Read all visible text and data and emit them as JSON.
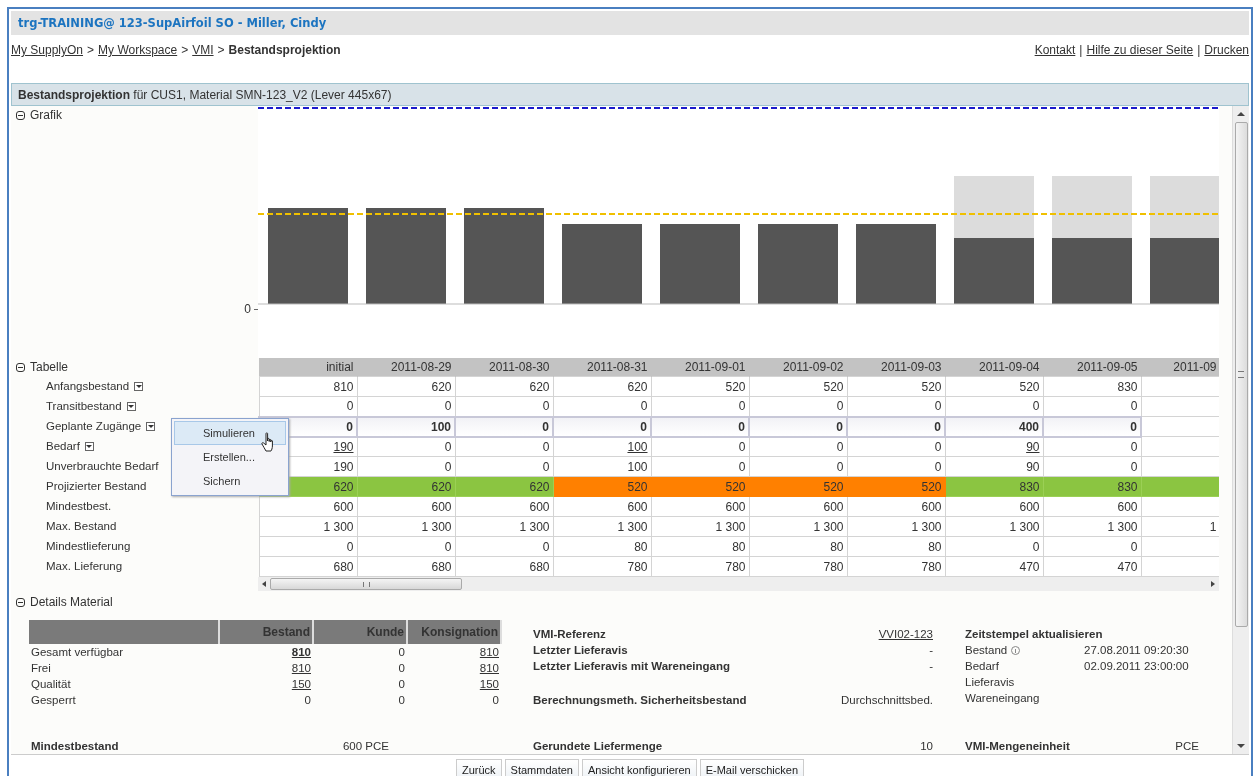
{
  "window": {
    "title": "trg-TRAINING@ 123-SupAirfoil SO - Miller, Cindy"
  },
  "breadcrumb": [
    {
      "kind": "link",
      "label": "My SupplyOn"
    },
    {
      "kind": "separator",
      "label": ">"
    },
    {
      "kind": "link",
      "label": "My Workspace"
    },
    {
      "kind": "separator",
      "label": ">"
    },
    {
      "kind": "link",
      "label": "VMI"
    },
    {
      "kind": "separator",
      "label": ">"
    },
    {
      "kind": "current",
      "label": "Bestandsprojektion"
    }
  ],
  "top_links": [
    {
      "kind": "link",
      "label": "Kontakt"
    },
    {
      "kind": "separator",
      "label": "|"
    },
    {
      "kind": "link",
      "label": "Hilfe zu dieser Seite"
    },
    {
      "kind": "separator",
      "label": "|"
    },
    {
      "kind": "link",
      "label": "Drucken"
    }
  ],
  "panel": {
    "title": "**Bestandsprojektion** für CUS1, Material SMN-123_V2 (Lever 445x67)"
  },
  "chart": {
    "label": "Grafik",
    "expanded": true,
    "y_tick": "0"
  },
  "table": {
    "label": "Tabelle",
    "expanded": true,
    "columns": [
      "initial",
      "2011-08-29",
      "2011-08-30",
      "2011-08-31",
      "2011-09-01",
      "2011-09-02",
      "2011-09-03",
      "2011-09-04",
      "2011-09-05",
      "2011-09"
    ],
    "rows": [
      {
        "label": "Anfangsbestand",
        "kind": "plain",
        "menu": true,
        "menu_open": false,
        "cells": [
          "810",
          "620",
          "620",
          "620",
          "520",
          "520",
          "520",
          "520",
          "830"
        ]
      },
      {
        "label": "Transitbestand",
        "kind": "plain",
        "menu": true,
        "menu_open": false,
        "cells": [
          "0",
          "0",
          "0",
          "0",
          "0",
          "0",
          "0",
          "0",
          "0"
        ]
      },
      {
        "label": "Geplante Zugänge",
        "kind": "input",
        "menu": true,
        "menu_open": true,
        "cells": [
          "0",
          "100",
          "0",
          "0",
          "0",
          "0",
          "0",
          "400",
          "0"
        ]
      },
      {
        "label": "Bedarf",
        "kind": "plain",
        "menu": true,
        "menu_open": false,
        "cells": [
          {
            "text": "190",
            "link": true
          },
          "0",
          "0",
          {
            "text": "100",
            "link": true
          },
          "0",
          "0",
          "0",
          {
            "text": "90",
            "link": true
          },
          "0"
        ]
      },
      {
        "label": "Unverbrauchte Bedarf",
        "kind": "plain",
        "menu": false,
        "cells": [
          "190",
          "0",
          "0",
          "100",
          "0",
          "0",
          "0",
          "90",
          "0"
        ]
      },
      {
        "label": "Projizierter Bestand",
        "kind": "status",
        "menu": false,
        "cells": [
          {
            "text": "620",
            "color": "#8bc541"
          },
          {
            "text": "620",
            "color": "#8bc541"
          },
          {
            "text": "620",
            "color": "#8bc541"
          },
          {
            "text": "520",
            "color": "#ff8000"
          },
          {
            "text": "520",
            "color": "#ff8000"
          },
          {
            "text": "520",
            "color": "#ff8000"
          },
          {
            "text": "520",
            "color": "#ff8000"
          },
          {
            "text": "830",
            "color": "#8bc541"
          },
          {
            "text": "830",
            "color": "#8bc541"
          },
          {
            "color": "#8bc541"
          }
        ]
      },
      {
        "label": "Mindestbest.",
        "kind": "plain",
        "menu": false,
        "cells": [
          "600",
          "600",
          "600",
          "600",
          "600",
          "600",
          "600",
          "600",
          "600"
        ]
      },
      {
        "label": "Max. Bestand",
        "kind": "plain",
        "menu": false,
        "cells": [
          "1 300",
          "1 300",
          "1 300",
          "1 300",
          "1 300",
          "1 300",
          "1 300",
          "1 300",
          "1 300",
          "1"
        ]
      },
      {
        "label": "Mindestlieferung",
        "kind": "plain",
        "menu": false,
        "cells": [
          "0",
          "0",
          "0",
          "80",
          "80",
          "80",
          "80",
          "0",
          "0"
        ]
      },
      {
        "label": "Max. Lieferung",
        "kind": "plain",
        "menu": false,
        "cells": [
          "680",
          "680",
          "680",
          "780",
          "780",
          "780",
          "780",
          "470",
          "470"
        ]
      }
    ],
    "menu": {
      "items": [
        {
          "label": "Simulieren",
          "selected": true
        },
        {
          "label": "Erstellen...",
          "selected": false
        },
        {
          "label": "Sichern",
          "selected": false
        }
      ]
    }
  },
  "details": {
    "label": "Details Material",
    "expanded": true,
    "stock": {
      "columns": [
        "Bestand",
        "Kunde",
        "Konsignation"
      ],
      "rows": [
        {
          "label": "Gesamt verfügbar",
          "cells": [
            {
              "text": "810",
              "link": true,
              "bold": true
            },
            {
              "text": "0"
            },
            {
              "text": "810",
              "link": true
            }
          ]
        },
        {
          "label": "Frei",
          "cells": [
            {
              "text": "810",
              "link": true
            },
            {
              "text": "0"
            },
            {
              "text": "810",
              "link": true
            }
          ]
        },
        {
          "label": "Qualität",
          "cells": [
            {
              "text": "150",
              "link": true
            },
            {
              "text": "0"
            },
            {
              "text": "150",
              "link": true
            }
          ]
        },
        {
          "label": "Gesperrt",
          "cells": [
            {
              "text": "0"
            },
            {
              "text": "0"
            },
            {
              "text": "0"
            }
          ]
        }
      ]
    },
    "vmi": [
      {
        "label": "VMI-Referenz",
        "value": "VVI02-123",
        "link": true
      },
      {
        "label": "Letzter Lieferavis",
        "value": "-"
      },
      {
        "label": "Letzter Lieferavis mit Wareneingang",
        "value": "-"
      },
      {
        "kind": "gap"
      },
      {
        "label": "Berechnungsmeth. Sicherheitsbestand",
        "value": "Durchschnittsbed."
      }
    ],
    "timestamps": {
      "title": "Zeitstempel aktualisieren",
      "rows": [
        {
          "label": "Bestand",
          "value": "27.08.2011 09:20:30",
          "info": true
        },
        {
          "label": "Bedarf",
          "value": "02.09.2011 23:00:00"
        },
        {
          "label": "Lieferavis"
        },
        {
          "label": "Wareneingang"
        }
      ]
    },
    "bottom": [
      {
        "label": "Mindestbestand",
        "value": "600 PCE"
      },
      {
        "label": "Gerundete Liefermenge",
        "value": "10"
      },
      {
        "label": "VMI-Mengeneinheit",
        "value": "PCE"
      }
    ]
  },
  "buttons": [
    "Zurück",
    "Stammdaten",
    "Ansicht konfigurieren",
    "E-Mail verschicken"
  ]
}
